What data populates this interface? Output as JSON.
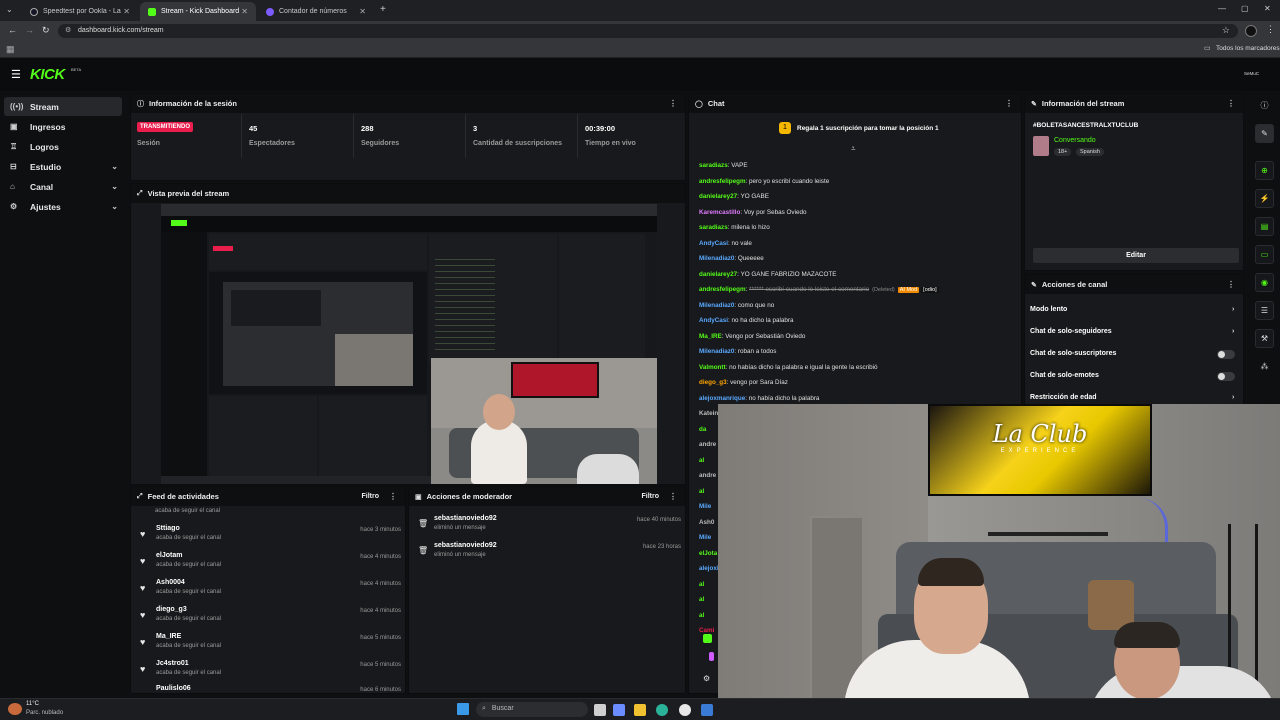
{
  "browser": {
    "tabs": [
      {
        "title": "Speedtest por Ookla - La prueb..."
      },
      {
        "title": "Stream - Kick Dashboard"
      },
      {
        "title": "Contador de números"
      }
    ],
    "url": "dashboard.kick.com/stream",
    "bookmarks_label": "Todos los marcadores"
  },
  "app": {
    "logo": "KICK",
    "logo_badge": "BETA",
    "user_tag": "SeMuC"
  },
  "sidebar": {
    "items": [
      {
        "label": "Stream"
      },
      {
        "label": "Ingresos"
      },
      {
        "label": "Logros"
      },
      {
        "label": "Estudio"
      },
      {
        "label": "Canal"
      },
      {
        "label": "Ajustes"
      }
    ]
  },
  "session": {
    "title": "Información de la sesión",
    "status_badge": "TRANSMITIENDO",
    "session_label": "Sesión",
    "stats": [
      {
        "value": "45",
        "label": "Espectadores"
      },
      {
        "value": "288",
        "label": "Seguidores"
      },
      {
        "value": "3",
        "label": "Cantidad de suscripciones"
      },
      {
        "value": "00:39:00",
        "label": "Tiempo en vivo"
      }
    ]
  },
  "preview": {
    "title": "Vista previa del stream"
  },
  "activity": {
    "title": "Feed de actividades",
    "filter": "Filtro",
    "top_partial": "acaba de seguir el canal",
    "rows": [
      {
        "name": "Sttiago",
        "sub": "acaba de seguir el canal",
        "time": "hace 3 minutos"
      },
      {
        "name": "elJotam",
        "sub": "acaba de seguir el canal",
        "time": "hace 4 minutos"
      },
      {
        "name": "Ash0004",
        "sub": "acaba de seguir el canal",
        "time": "hace 4 minutos"
      },
      {
        "name": "diego_g3",
        "sub": "acaba de seguir el canal",
        "time": "hace 4 minutos"
      },
      {
        "name": "Ma_IRE",
        "sub": "acaba de seguir el canal",
        "time": "hace 5 minutos"
      },
      {
        "name": "Jc4stro01",
        "sub": "acaba de seguir el canal",
        "time": "hace 5 minutos"
      },
      {
        "name": "Paulislo06",
        "sub": "",
        "time": "hace 6 minutos"
      }
    ]
  },
  "modactions": {
    "title": "Acciones de moderador",
    "filter": "Filtro",
    "rows": [
      {
        "name": "sebastianoviedo92",
        "sub": "eliminó un mensaje",
        "time": "hace 40 minutos"
      },
      {
        "name": "sebastianoviedo92",
        "sub": "eliminó un mensaje",
        "time": "hace 23 horas"
      }
    ]
  },
  "chat": {
    "title": "Chat",
    "pinned": "Regala 1 suscripción para tomar la posición 1",
    "messages": [
      {
        "user": "saradiazs",
        "text": "VAPE",
        "color": "#53fc18"
      },
      {
        "user": "andresfelipegm",
        "text": "pero yo escribí cuando leiste",
        "color": "#53fc18"
      },
      {
        "user": "danielarey27",
        "text": "YO GABE",
        "color": "#53fc18"
      },
      {
        "user": "Karemcastillo",
        "text": "Voy por Sebas Oviedo",
        "color": "#e07bff"
      },
      {
        "user": "saradiazs",
        "text": "milena lo hizo",
        "color": "#53fc18"
      },
      {
        "user": "AndyCasi",
        "text": "no vale",
        "color": "#5aa9ff"
      },
      {
        "user": "Milenadiaz0",
        "text": "Queeeee",
        "color": "#5aa9ff"
      },
      {
        "user": "danielarey27",
        "text": "YO GANE FABRIZIO MAZACOTE",
        "color": "#53fc18"
      },
      {
        "user": "andresfelipegm",
        "text": "****** escribí cuando lo leiste el comentario",
        "color": "#53fc18",
        "deleted": "(Deleted)",
        "tag": "AI Mod",
        "tag2": "[odio]"
      },
      {
        "user": "Milenadiaz0",
        "text": "como que no",
        "color": "#5aa9ff"
      },
      {
        "user": "AndyCasi",
        "text": "no ha dicho la palabra",
        "color": "#5aa9ff"
      },
      {
        "user": "Ma_IRE",
        "text": "Vengo por Sebastián Oviedo",
        "color": "#53fc18"
      },
      {
        "user": "Milenadiaz0",
        "text": "roban a todos",
        "color": "#5aa9ff"
      },
      {
        "user": "Valmontt",
        "text": "no habías dicho la palabra e igual la gente la escribió",
        "color": "#53fc18"
      },
      {
        "user": "diego_g3",
        "text": "vengo por Sara Díaz",
        "color": "#ffa500"
      },
      {
        "user": "alejoxmanrique",
        "text": "no había dicho la palabra",
        "color": "#5aa9ff"
      }
    ],
    "partial_users": [
      "Katein",
      "da",
      "andre",
      "al",
      "andre",
      "al",
      "Mile",
      "Ash0",
      "Mile",
      "elJota",
      "alejoxi",
      "al",
      "al",
      "al",
      "Cami"
    ]
  },
  "stream_info": {
    "title": "Información del stream",
    "stream_title": "#BOLETASANCESTRALXTUCLUB",
    "category": "Conversando",
    "tags": [
      "18+",
      "Spanish"
    ],
    "edit_button": "Editar"
  },
  "channel_actions": {
    "title": "Acciones de canal",
    "items": [
      {
        "label": "Modo lento",
        "control": "chevron"
      },
      {
        "label": "Chat de solo-seguidores",
        "control": "chevron"
      },
      {
        "label": "Chat de solo-suscriptores",
        "control": "toggle"
      },
      {
        "label": "Chat de solo-emotes",
        "control": "toggle"
      },
      {
        "label": "Restricción de edad",
        "control": "chevron"
      }
    ]
  },
  "overlay": {
    "logo_text": "La Club",
    "logo_sub": "EXPERIENCE"
  },
  "taskbar": {
    "weather_temp": "11°C",
    "weather_desc": "Parc. nublado",
    "search_placeholder": "Buscar"
  },
  "colors": {
    "kick_green": "#53fc18",
    "badge_red": "#e91e4d",
    "panel_bg": "#18191c",
    "app_bg": "#0e0f11"
  }
}
